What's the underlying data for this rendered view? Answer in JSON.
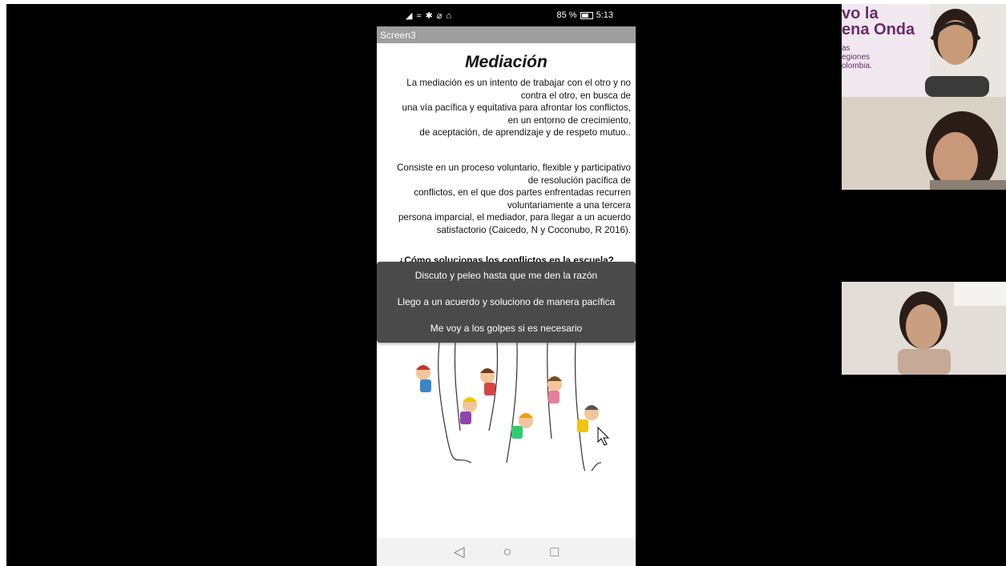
{
  "phone": {
    "status_icons": "◢ ≈ ✱ ⌀ ⌂",
    "battery_text": "85 %",
    "time": "5:13",
    "screen_title": "Screen3"
  },
  "content": {
    "title": "Mediación",
    "paragraph1": [
      "La mediación es un intento de trabajar con el otro y no",
      "contra el otro, en busca de",
      "una vía pacífica y equitativa para afrontar los conflictos,",
      "en un entorno de crecimiento,",
      "de aceptación, de aprendizaje y de respeto mutuo.."
    ],
    "paragraph2": [
      "Consiste en un proceso voluntario, flexible y participativo",
      "de resolución pacífica de",
      "conflictos, en el que dos partes enfrentadas recurren",
      "voluntariamente a una tercera",
      "persona imparcial, el mediador, para llegar a un acuerdo",
      "satisfactorio (Caicedo, N y Coconubo, R 2016)."
    ],
    "question": "¿Cómo solucionas los conflictos en la escuela?"
  },
  "menu": {
    "options": [
      "Discuto y peleo hasta que me den la razón",
      "Llego a un acuerdo y soluciono de manera pacífica",
      "Me voy a los golpes si es necesario"
    ]
  },
  "navbar": {
    "back_icon": "back-icon",
    "home_icon": "home-icon",
    "recents_icon": "recents-icon"
  },
  "participants": {
    "banner_lines": [
      "vo la",
      "ena Onda"
    ],
    "banner_small": [
      "as",
      "egiones",
      "olombia."
    ]
  },
  "colors": {
    "menu_bg": "#4a4a4a",
    "titlebar_bg": "#9e9e9e",
    "banner_purple": "#6b2a6b"
  }
}
